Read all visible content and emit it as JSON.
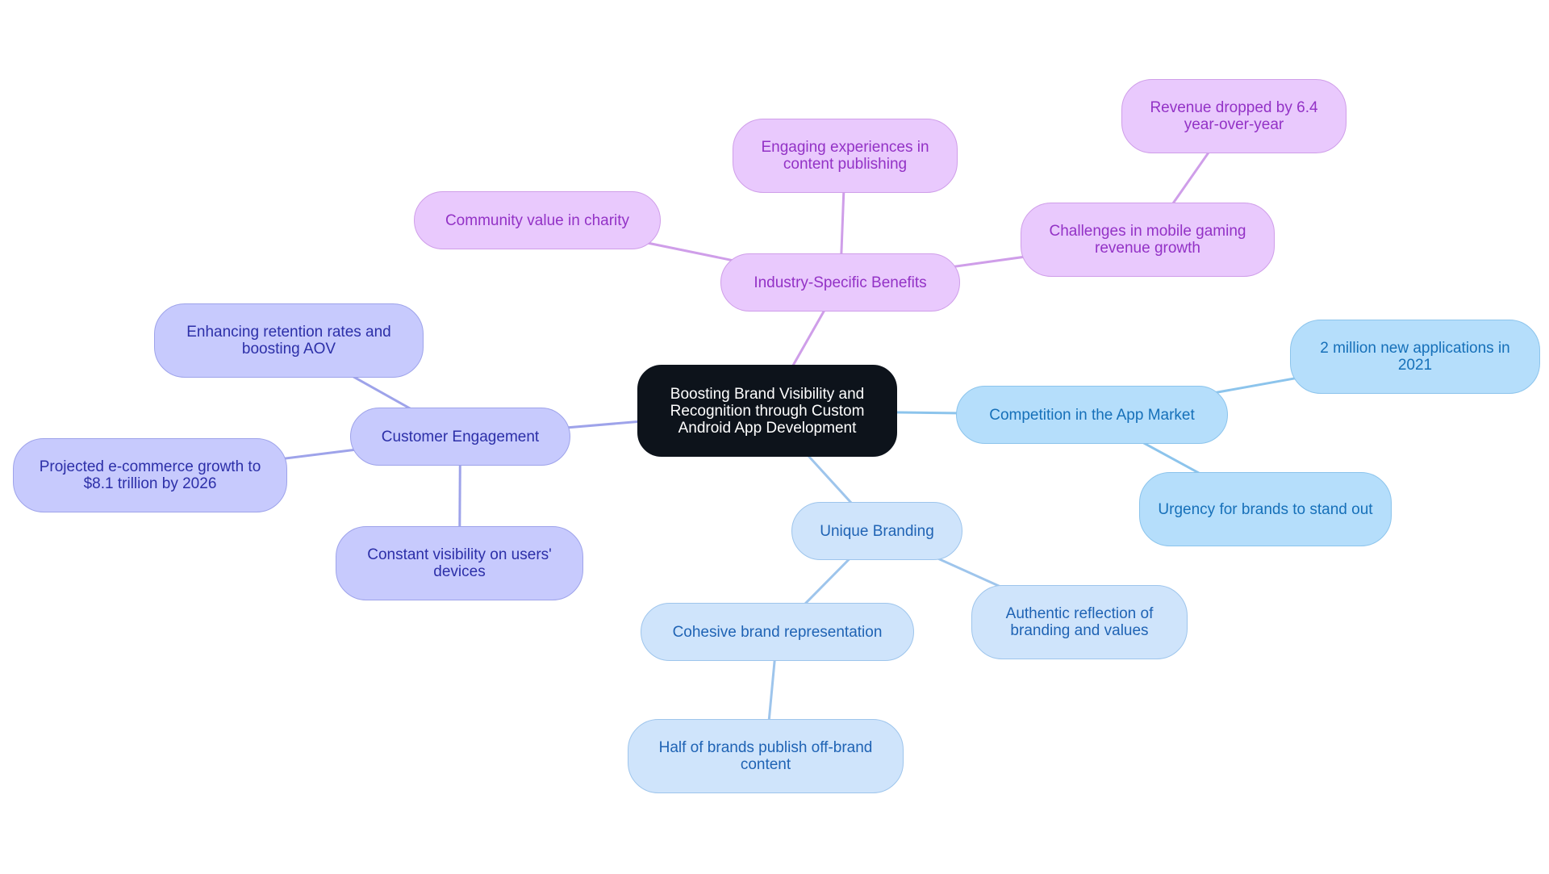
{
  "diagram": {
    "type": "mind-map",
    "colors": {
      "root_fill": "#0d131b",
      "purple_fill": "#e9c9fd",
      "purple_edge": "#cf9ee9",
      "indigo_fill": "#c7cafd",
      "indigo_edge": "#9ea3ea",
      "lightblue_fill": "#cfe4fb",
      "lightblue_edge": "#9ec5ec",
      "skyblue_fill": "#b5defb",
      "skyblue_edge": "#8cc4ec"
    },
    "root": {
      "label": "Boosting Brand Visibility and Recognition through Custom Android App Development"
    },
    "branches": [
      {
        "id": "industry",
        "label": "Industry-Specific Benefits",
        "children": [
          {
            "id": "charity",
            "label": "Community value in charity"
          },
          {
            "id": "publishing",
            "label": "Engaging experiences in content publishing"
          },
          {
            "id": "gaming",
            "label": "Challenges in mobile gaming revenue growth",
            "children": [
              {
                "id": "revenue",
                "label": "Revenue dropped by 6.4 year-over-year"
              }
            ]
          }
        ]
      },
      {
        "id": "competition",
        "label": "Competition in the App Market",
        "children": [
          {
            "id": "apps2021",
            "label": "2 million new applications in 2021"
          },
          {
            "id": "urgency",
            "label": "Urgency for brands to stand out"
          }
        ]
      },
      {
        "id": "branding",
        "label": "Unique Branding",
        "children": [
          {
            "id": "cohesive",
            "label": "Cohesive brand representation",
            "children": [
              {
                "id": "offbrand",
                "label": "Half of brands publish off-brand content"
              }
            ]
          },
          {
            "id": "authentic",
            "label": "Authentic reflection of branding and values"
          }
        ]
      },
      {
        "id": "engagement",
        "label": "Customer Engagement",
        "children": [
          {
            "id": "retention",
            "label": "Enhancing retention rates and boosting AOV"
          },
          {
            "id": "ecommerce",
            "label": "Projected e-commerce growth to $8.1 trillion by 2026"
          },
          {
            "id": "visibility",
            "label": "Constant visibility on users' devices"
          }
        ]
      }
    ]
  }
}
